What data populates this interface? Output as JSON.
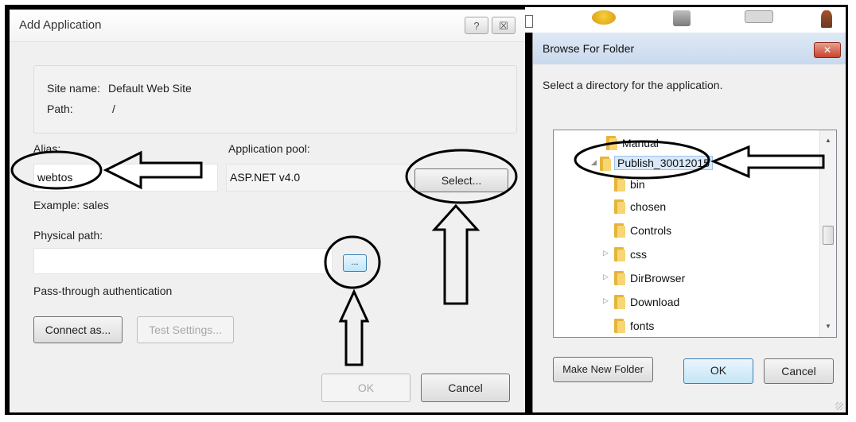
{
  "add_dialog": {
    "title": "Add Application",
    "help_glyph": "?",
    "close_glyph": "☒",
    "site_name_label": "Site name:",
    "site_name_value": "Default Web Site",
    "path_label": "Path:",
    "path_value": "/",
    "alias_label": "Alias:",
    "alias_value": "webtos",
    "app_pool_label": "Application pool:",
    "app_pool_value": "ASP.NET v4.0",
    "select_button": "Select...",
    "example_text": "Example: sales",
    "physical_path_label": "Physical path:",
    "physical_path_value": "",
    "browse_button": "...",
    "pass_through_label": "Pass-through authentication",
    "connect_as_button": "Connect as...",
    "test_settings_button": "Test Settings...",
    "ok_button": "OK",
    "cancel_button": "Cancel"
  },
  "browse_dialog": {
    "title": "Browse For Folder",
    "close_glyph": "✕",
    "instruction": "Select a directory for the application.",
    "tree_items": [
      {
        "name": "Manual",
        "expander": ""
      },
      {
        "name": "Publish_30012015",
        "expander": "◢",
        "selected": true
      },
      {
        "name": "bin",
        "expander": ""
      },
      {
        "name": "chosen",
        "expander": ""
      },
      {
        "name": "Controls",
        "expander": ""
      },
      {
        "name": "css",
        "expander": "▷"
      },
      {
        "name": "DirBrowser",
        "expander": "▷"
      },
      {
        "name": "Download",
        "expander": "▷"
      },
      {
        "name": "fonts",
        "expander": ""
      }
    ],
    "scroll_up_glyph": "▲",
    "scroll_down_glyph": "▼",
    "make_new_folder_button": "Make New Folder",
    "ok_button": "OK",
    "cancel_button": "Cancel"
  },
  "colors": {
    "annotation": "#000000",
    "folder": "#f2c94c",
    "selection": "#d9e9fb",
    "close_button": "#c9432d"
  }
}
